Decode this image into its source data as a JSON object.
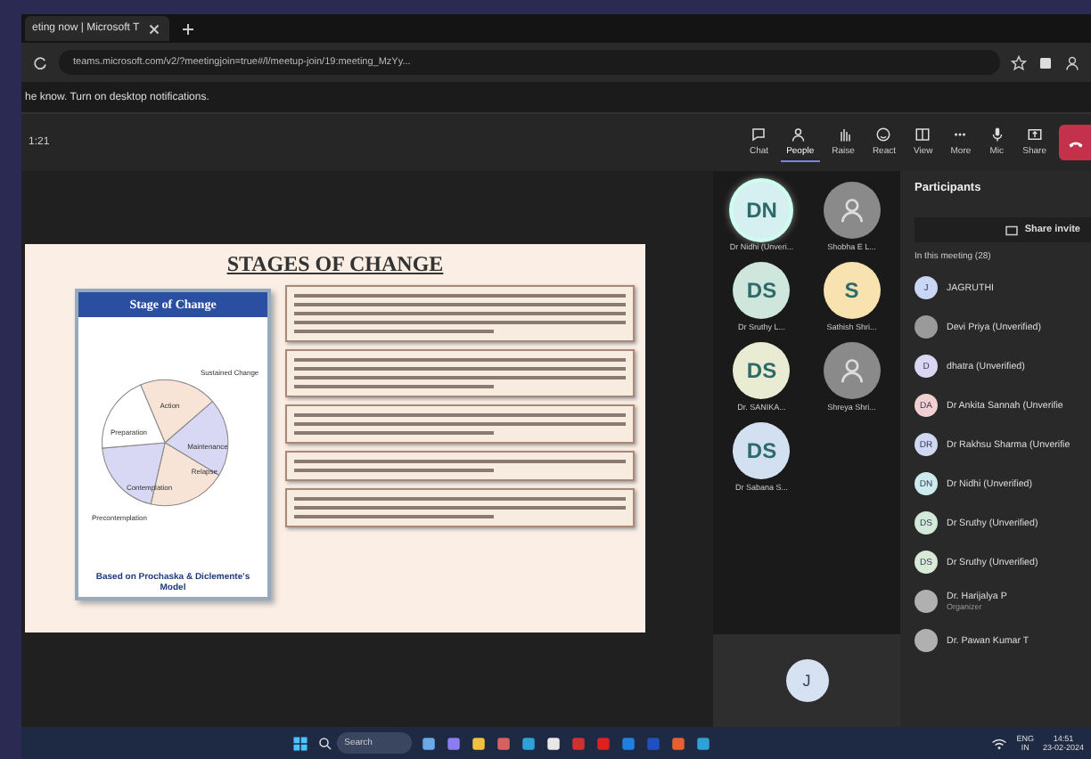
{
  "browser": {
    "tab_title": "eting now | Microsoft T",
    "url": "teams.microsoft.com/v2/?meetingjoin=true#/l/meetup-join/19:meeting_MzYy...",
    "notification": "he know. Turn on desktop notifications."
  },
  "meeting_toolbar": {
    "timer": "1:21",
    "buttons": [
      {
        "kind": "chat",
        "label": "Chat",
        "selected": false
      },
      {
        "kind": "people",
        "label": "People",
        "selected": true
      },
      {
        "kind": "raise",
        "label": "Raise",
        "selected": false
      },
      {
        "kind": "react",
        "label": "React",
        "selected": false
      },
      {
        "kind": "view",
        "label": "View",
        "selected": false
      },
      {
        "kind": "more",
        "label": "More",
        "selected": false
      },
      {
        "kind": "mic",
        "label": "Mic",
        "selected": false
      },
      {
        "kind": "share",
        "label": "Share",
        "selected": false
      }
    ]
  },
  "slide": {
    "title": "STAGES OF CHANGE",
    "diagram_title": "Stage of Change",
    "outer_label": "Sustained Change",
    "stages": [
      "Action",
      "Preparation",
      "Maintenance",
      "Relapse",
      "Contemplation",
      "Precontemplation"
    ],
    "caption": "Based on Prochaska & Diclemente's Model"
  },
  "video_tiles": [
    {
      "initials": "DN",
      "name": "Dr Nidhi (Unveri...",
      "color": "#d6f0f2",
      "speaking": true
    },
    {
      "name": "Shobha E L...",
      "color": "#8a8a8a",
      "speaking": false
    },
    {
      "initials": "DS",
      "name": "Dr Sruthy L...",
      "color": "#cfe6dc",
      "speaking": false
    },
    {
      "initials": "S",
      "name": "Sathish Shri...",
      "color": "#f7e2b0",
      "speaking": false
    },
    {
      "initials": "DS",
      "name": "Dr. SANIKA...",
      "color": "#e9ecd2",
      "speaking": false
    },
    {
      "name": "Shreya Shri...",
      "color": "#8a8a8a",
      "speaking": false
    },
    {
      "initials": "DS",
      "name": "Dr Sabana S...",
      "color": "#d3e0f2",
      "speaking": false
    }
  ],
  "self_view": {
    "initials": "J"
  },
  "participants": {
    "title": "Participants",
    "share_button": "Share invite",
    "section": "In this meeting (28)",
    "people": [
      {
        "initials": "J",
        "name": "JAGRUTHI",
        "color": "#c9d6f5"
      },
      {
        "name": "Devi Priya (Unverified)",
        "color": "#9a9a9a"
      },
      {
        "initials": "D",
        "name": "dhatra (Unverified)",
        "color": "#d8d6f2"
      },
      {
        "initials": "DA",
        "name": "Dr Ankita Sannah (Unverifie",
        "color": "#f2cfd3"
      },
      {
        "initials": "DR",
        "name": "Dr Rakhsu Sharma (Unverifie",
        "color": "#cfd8f0"
      },
      {
        "initials": "DN",
        "name": "Dr Nidhi (Unverified)",
        "color": "#cdebee"
      },
      {
        "initials": "DS",
        "name": "Dr Sruthy (Unverified)",
        "color": "#d2e8d8"
      },
      {
        "initials": "DS",
        "name": "Dr Sruthy (Unverified)",
        "color": "#d6ead6"
      },
      {
        "name": "Dr. Harijalya P",
        "role": "Organizer",
        "color": "#b0b0b0"
      },
      {
        "name": "Dr. Pawan Kumar T",
        "color": "#b0b0b0"
      }
    ]
  },
  "taskbar": {
    "search_placeholder": "Search",
    "language": "ENG",
    "region": "IN",
    "time": "14:51",
    "date": "23-02-2024"
  }
}
